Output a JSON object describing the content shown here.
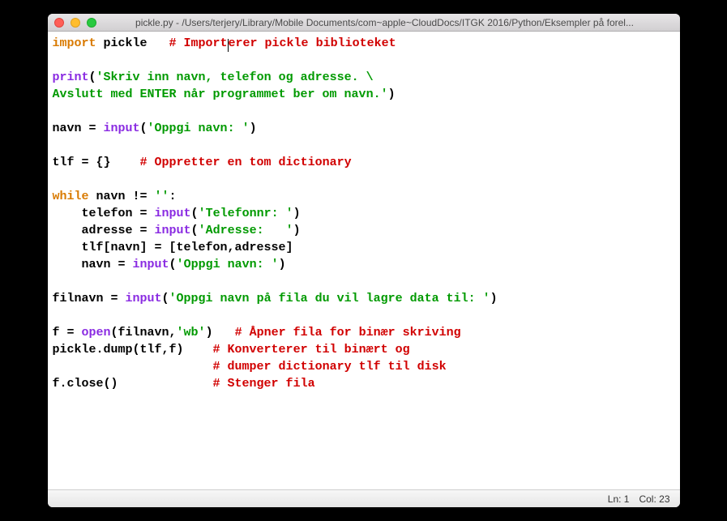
{
  "window": {
    "title": "pickle.py - /Users/terjery/Library/Mobile Documents/com~apple~CloudDocs/ITGK 2016/Python/Eksempler på forel..."
  },
  "code": {
    "l1": {
      "kw": "import",
      "mod": " pickle   ",
      "comment": "# Importerer pickle biblioteket"
    },
    "l3a": "print",
    "l3b": "(",
    "l3c": "'Skriv inn navn, telefon og adresse. \\",
    "l4a": "Avslutt med ENTER når programmet ber om navn.'",
    "l4b": ")",
    "l6a": "navn = ",
    "l6b": "input",
    "l6c": "(",
    "l6d": "'Oppgi navn: '",
    "l6e": ")",
    "l8a": "tlf = {}    ",
    "l8b": "# Oppretter en tom dictionary",
    "l10a": "while",
    "l10b": " navn != ",
    "l10c": "''",
    "l10d": ":",
    "l11a": "    telefon = ",
    "l11b": "input",
    "l11c": "(",
    "l11d": "'Telefonnr: '",
    "l11e": ")",
    "l12a": "    adresse = ",
    "l12b": "input",
    "l12c": "(",
    "l12d": "'Adresse:   '",
    "l12e": ")",
    "l13": "    tlf[navn] = [telefon,adresse]",
    "l14a": "    navn = ",
    "l14b": "input",
    "l14c": "(",
    "l14d": "'Oppgi navn: '",
    "l14e": ")",
    "l16a": "filnavn = ",
    "l16b": "input",
    "l16c": "(",
    "l16d": "'Oppgi navn på fila du vil lagre data til: '",
    "l16e": ")",
    "l18a": "f = ",
    "l18b": "open",
    "l18c": "(filnavn,",
    "l18d": "'wb'",
    "l18e": ")   ",
    "l18f": "# Åpner fila for binær skriving",
    "l19a": "pickle.dump(tlf,f)    ",
    "l19b": "# Konverterer til binært og",
    "l20a": "                      ",
    "l20b": "# dumper dictionary tlf til disk",
    "l21a": "f.close()             ",
    "l21b": "# Stenger fila"
  },
  "status": {
    "line": "Ln: 1",
    "col": "Col: 23"
  }
}
